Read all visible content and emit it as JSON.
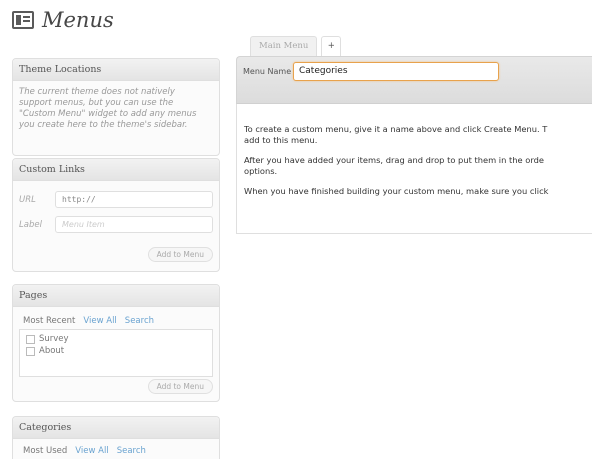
{
  "page": {
    "title": "Menus"
  },
  "theme_locations": {
    "heading": "Theme Locations",
    "notice_lines": [
      "The current theme does not natively",
      "support menus, but you can use the",
      "\"Custom Menu\" widget to add any menus",
      "you create here to the theme's sidebar."
    ]
  },
  "custom_links": {
    "heading": "Custom Links",
    "url_label": "URL",
    "url_value": "http://",
    "label_label": "Label",
    "label_placeholder": "Menu Item",
    "add_button": "Add to Menu"
  },
  "pages": {
    "heading": "Pages",
    "tabs": [
      "Most Recent",
      "View All",
      "Search"
    ],
    "items": [
      "Survey",
      "About"
    ],
    "add_button": "Add to Menu"
  },
  "categories": {
    "heading": "Categories",
    "tabs": [
      "Most Used",
      "View All",
      "Search"
    ]
  },
  "menu_tabs": {
    "active": "Main Menu",
    "add": "+"
  },
  "menu_editor": {
    "name_label": "Menu Name",
    "name_value": "Categories",
    "instructions": [
      "To create a custom menu, give it a name above and click Create Menu. T",
      "add to this menu.",
      "After you have added your items, drag and drop to put them in the orde",
      "options.",
      "When you have finished building your custom menu, make sure you click"
    ]
  },
  "colors": {
    "link": "#6aa3d0",
    "input_focus_border": "#e8a24c"
  }
}
